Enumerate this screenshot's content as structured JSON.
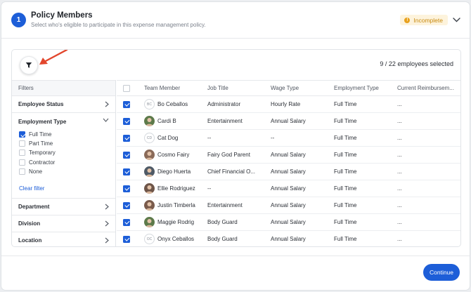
{
  "step": {
    "number": "1"
  },
  "header": {
    "title": "Policy Members",
    "subtitle": "Select who's eligible to participate in this expense management policy.",
    "status": "Incomplete",
    "status_icon": "!"
  },
  "toolbar": {
    "selected_count": "9 / 22 employees selected"
  },
  "filters": {
    "heading": "Filters",
    "groups": {
      "employee_status": "Employee Status",
      "employment_type": "Employment Type",
      "department": "Department",
      "division": "Division",
      "location": "Location"
    },
    "employment_type_options": [
      {
        "label": "Full Time",
        "checked": true
      },
      {
        "label": "Part Time",
        "checked": false
      },
      {
        "label": "Temporary",
        "checked": false
      },
      {
        "label": "Contractor",
        "checked": false
      },
      {
        "label": "None",
        "checked": false
      }
    ],
    "clear_label": "Clear filter"
  },
  "table": {
    "columns": [
      "Team Member",
      "Job Title",
      "Wage Type",
      "Employment Type",
      "Current Reimbursem..."
    ],
    "rows": [
      {
        "avatar": "BC",
        "avatar_kind": "initials",
        "name": "Bo Ceballos",
        "job": "Administrator",
        "wage": "Hourly Rate",
        "employment": "Full Time",
        "reimb": "..."
      },
      {
        "avatar": "",
        "avatar_kind": "photo",
        "name": "Cardi B",
        "job": "Entertainment",
        "wage": "Annual Salary",
        "employment": "Full Time",
        "reimb": "..."
      },
      {
        "avatar": "CD",
        "avatar_kind": "initials",
        "name": "Cat Dog",
        "job": "--",
        "wage": "--",
        "employment": "Full Time",
        "reimb": "..."
      },
      {
        "avatar": "",
        "avatar_kind": "photo",
        "name": "Cosmo Fairy",
        "job": "Fairy God Parent",
        "wage": "Annual Salary",
        "employment": "Full Time",
        "reimb": "..."
      },
      {
        "avatar": "",
        "avatar_kind": "photo",
        "name": "Diego Huerta",
        "job": "Chief Financial O...",
        "wage": "Annual Salary",
        "employment": "Full Time",
        "reimb": "..."
      },
      {
        "avatar": "",
        "avatar_kind": "photo",
        "name": "Ellie Rodriguez",
        "job": "--",
        "wage": "Annual Salary",
        "employment": "Full Time",
        "reimb": "..."
      },
      {
        "avatar": "",
        "avatar_kind": "photo",
        "name": "Justin Timberla",
        "job": "Entertainment",
        "wage": "Annual Salary",
        "employment": "Full Time",
        "reimb": "..."
      },
      {
        "avatar": "",
        "avatar_kind": "photo",
        "name": "Maggie Rodrig",
        "job": "Body Guard",
        "wage": "Annual Salary",
        "employment": "Full Time",
        "reimb": "..."
      },
      {
        "avatar": "OC",
        "avatar_kind": "initials",
        "name": "Onyx Ceballos",
        "job": "Body Guard",
        "wage": "Annual Salary",
        "employment": "Full Time",
        "reimb": "..."
      }
    ]
  },
  "footer": {
    "continue_label": "Continue"
  },
  "colors": {
    "accent": "#1d5ed8",
    "warning": "#e8a11c",
    "annotation": "#e2462c"
  }
}
